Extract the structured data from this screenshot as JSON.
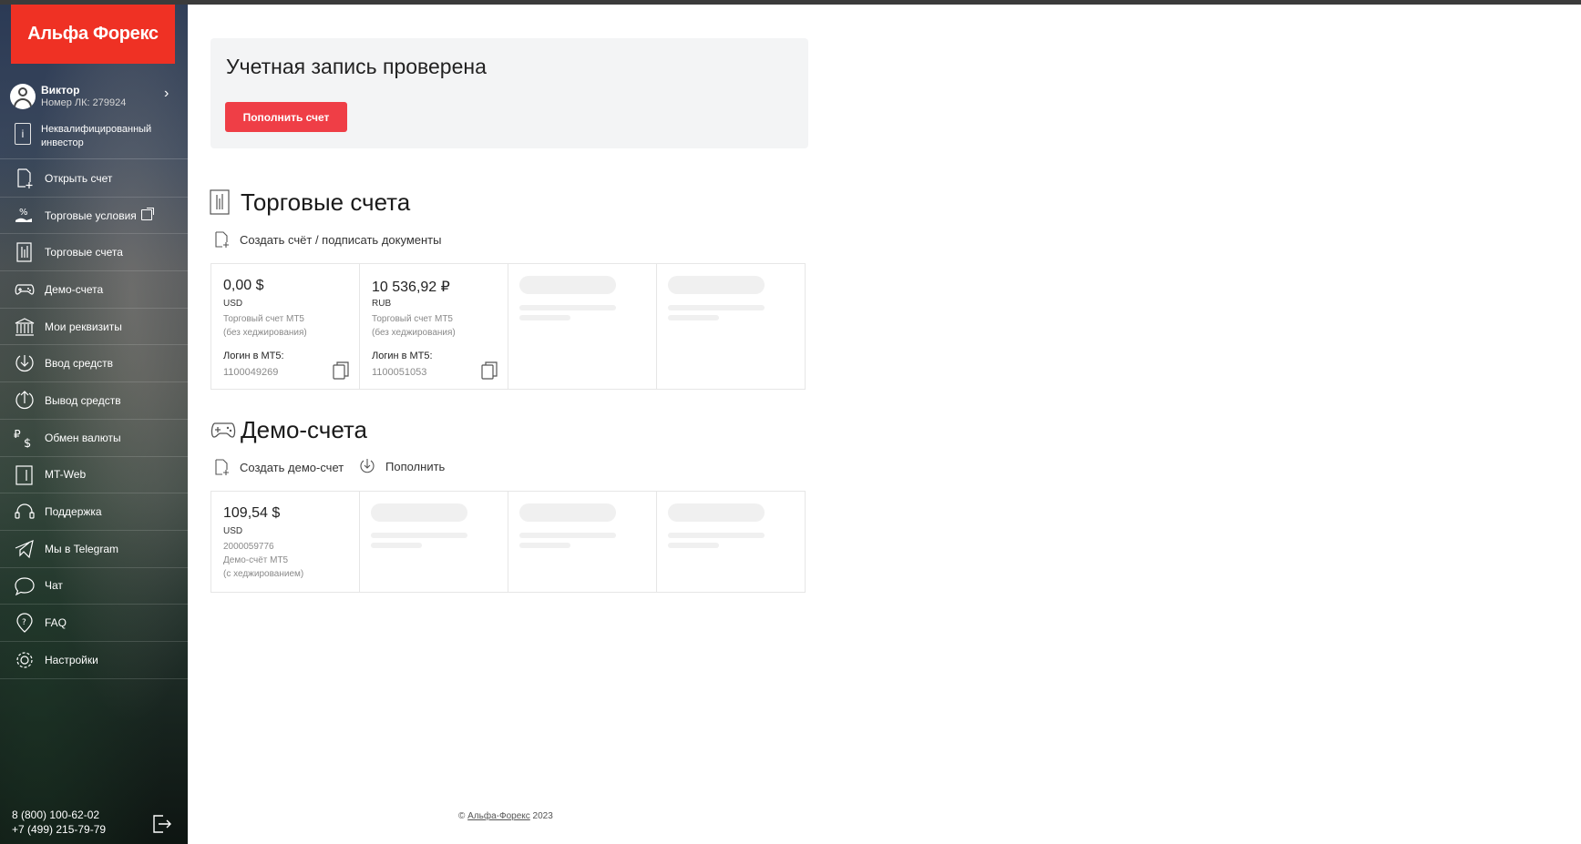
{
  "brand": {
    "name": "Альфа Форекс",
    "color": "#ef3124"
  },
  "user": {
    "name": "Виктор",
    "account_id": "Номер ЛК: 279924"
  },
  "status_label": "Неквалифицированный инвестор",
  "nav": [
    {
      "label": "Открыть счет",
      "icon": "new-document-icon"
    },
    {
      "label": "Торговые условия",
      "icon": "percent-hand-icon"
    },
    {
      "label": "Торговые счета",
      "icon": "chart-document-icon"
    },
    {
      "label": "Демо-счета",
      "icon": "gamepad-icon"
    },
    {
      "label": "Мои реквизиты",
      "icon": "bank-icon"
    },
    {
      "label": "Ввод средств",
      "icon": "deposit-icon"
    },
    {
      "label": "Вывод средств",
      "icon": "withdraw-icon"
    },
    {
      "label": "Обмен валюты",
      "icon": "currency-exchange-icon"
    },
    {
      "label": "MT-Web",
      "icon": "mt-web-icon"
    },
    {
      "label": "Поддержка",
      "icon": "headset-icon"
    },
    {
      "label": "Мы в Telegram",
      "icon": "telegram-icon"
    },
    {
      "label": "Чат",
      "icon": "chat-icon"
    },
    {
      "label": "FAQ",
      "icon": "faq-icon"
    },
    {
      "label": "Настройки",
      "icon": "gear-icon"
    }
  ],
  "phones": [
    "8 (800) 100-62-02",
    "+7 (499) 215-79-79"
  ],
  "verification": {
    "title": "Учетная запись проверена",
    "button": "Пополнить счет"
  },
  "trading": {
    "title": "Торговые счета",
    "action": "Создать счёт / подписать документы",
    "accounts": [
      {
        "amount": "0,00 $",
        "currency": "USD",
        "type": "Торговый счет MT5",
        "mode": "(без хеджирования)",
        "login_label": "Логин в MT5:",
        "login": "1100049269"
      },
      {
        "amount": "10 536,92 ₽",
        "currency": "RUB",
        "type": "Торговый счет MT5",
        "mode": "(без хеджирования)",
        "login_label": "Логин в MT5:",
        "login": "1100051053"
      }
    ]
  },
  "demo": {
    "title": "Демо-счета",
    "action_create": "Создать демо-счет",
    "action_topup": "Пополнить",
    "accounts": [
      {
        "amount": "109,54 $",
        "currency": "USD",
        "number": "2000059776",
        "type": "Демо-счёт MT5",
        "mode": "(с хеджированием)"
      }
    ]
  },
  "footer": {
    "copyright": "©",
    "link": "Альфа-Форекс",
    "year": "2023"
  }
}
